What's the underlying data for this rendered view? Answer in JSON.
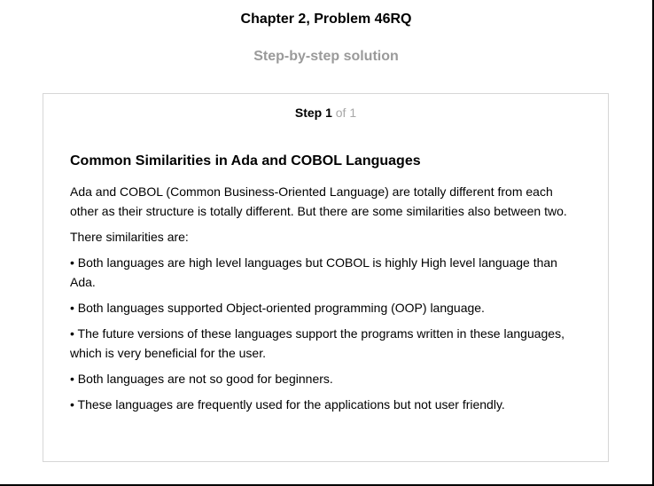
{
  "header": {
    "chapter_title": "Chapter 2, Problem 46RQ",
    "subtitle": "Step-by-step solution"
  },
  "step": {
    "label": "Step 1",
    "of_text": "of 1"
  },
  "content": {
    "heading": "Common Similarities in Ada and COBOL Languages",
    "paragraphs": [
      "Ada and COBOL (Common Business-Oriented Language) are totally different from each other as their structure is totally different. But there are some similarities also between two.",
      "There similarities are:",
      "• Both languages are high level languages but COBOL is highly High level language than Ada.",
      "• Both languages supported Object-oriented programming (OOP) language.",
      "• The future versions of these languages support the programs written in these languages, which is very beneficial for the user.",
      "• Both languages are not so good for beginners.",
      "• These languages are frequently used for the applications but not user friendly."
    ]
  }
}
